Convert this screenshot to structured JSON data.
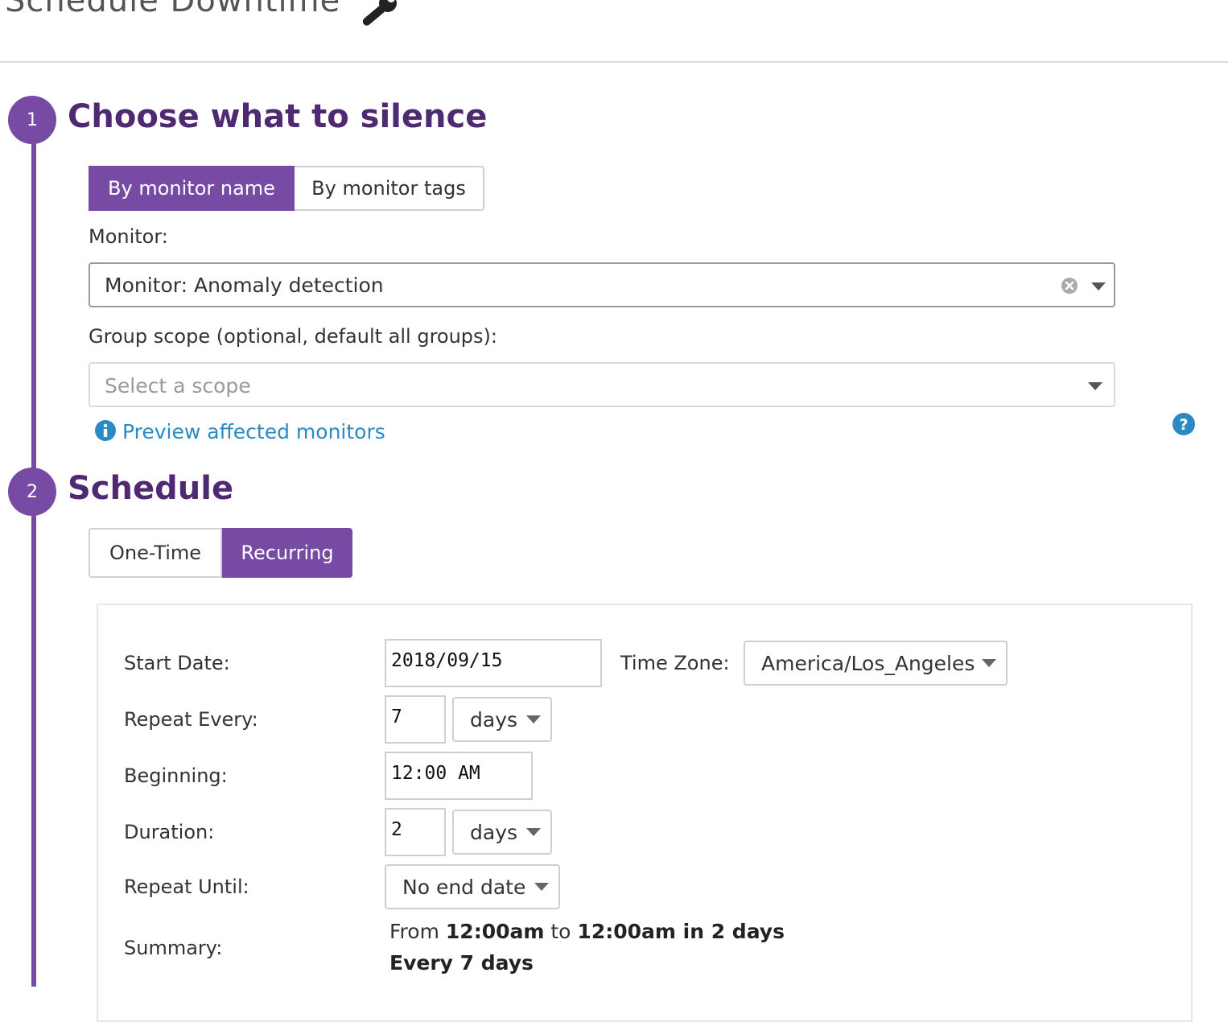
{
  "page": {
    "title": "Schedule Downtime",
    "title_icon": "wrench-icon"
  },
  "step1": {
    "number": "1",
    "heading": "Choose what to silence",
    "tabs": [
      {
        "label": "By monitor name",
        "active": true
      },
      {
        "label": "By monitor tags",
        "active": false
      }
    ],
    "monitor_label": "Monitor:",
    "monitor_value": "Monitor: Anomaly detection",
    "scope_label": "Group scope (optional, default all groups):",
    "scope_placeholder": "Select a scope",
    "preview_link": "Preview affected monitors"
  },
  "step2": {
    "number": "2",
    "heading": "Schedule",
    "tabs": [
      {
        "label": "One-Time",
        "active": false
      },
      {
        "label": "Recurring",
        "active": true
      }
    ],
    "form": {
      "start_date_label": "Start Date:",
      "start_date_value": "2018/09/15",
      "timezone_label": "Time Zone:",
      "timezone_value": "America/Los_Angeles",
      "repeat_every_label": "Repeat Every:",
      "repeat_every_value": "7",
      "repeat_every_unit": "days",
      "beginning_label": "Beginning:",
      "beginning_value": "12:00 AM",
      "duration_label": "Duration:",
      "duration_value": "2",
      "duration_unit": "days",
      "repeat_until_label": "Repeat Until:",
      "repeat_until_value": "No end date",
      "summary_label": "Summary:",
      "summary": {
        "from_word": "From",
        "start_time": "12:00am",
        "to_word": "to",
        "end_time": "12:00am in 2 days",
        "cadence": "Every 7 days"
      }
    }
  },
  "colors": {
    "accent": "#774aa4",
    "heading": "#4f2a73",
    "link": "#2a8ac4"
  }
}
